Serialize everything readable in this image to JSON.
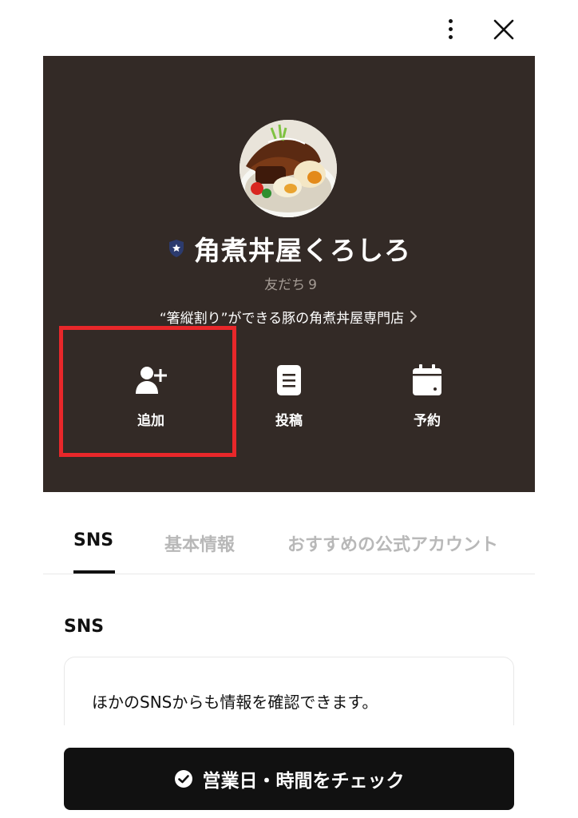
{
  "header": {
    "more_icon": "kebab-vertical-icon",
    "close_icon": "close-icon"
  },
  "profile": {
    "name": "角煮丼屋くろしろ",
    "verified_icon": "verified-shield-icon",
    "friends_label": "友だち",
    "friends_count": "9",
    "description": "“箸縦割り”ができる豚の角煮丼屋専門店",
    "hero_bg": "#332a26"
  },
  "actions": [
    {
      "label": "追加",
      "icon": "add-friend-icon"
    },
    {
      "label": "投稿",
      "icon": "post-icon"
    },
    {
      "label": "予約",
      "icon": "calendar-icon"
    }
  ],
  "highlight_color": "#e8272a",
  "tabs": [
    {
      "label": "SNS",
      "active": true
    },
    {
      "label": "基本情報",
      "active": false
    },
    {
      "label": "おすすめの公式アカウント",
      "active": false
    }
  ],
  "sns_section": {
    "title": "SNS",
    "card_text": "ほかのSNSからも情報を確認できます。"
  },
  "cta": {
    "label": "営業日・時間をチェック",
    "icon": "check-circle-icon"
  }
}
